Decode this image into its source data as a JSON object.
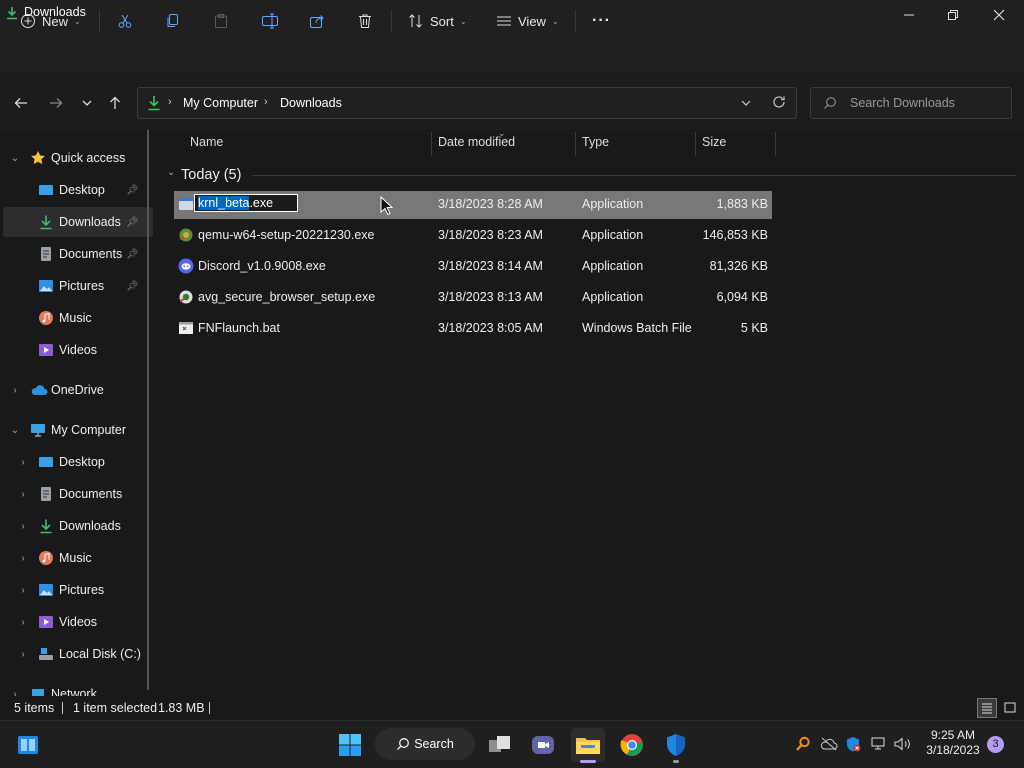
{
  "window": {
    "title": "Downloads"
  },
  "toolbar": {
    "new_label": "New",
    "sort_label": "Sort",
    "view_label": "View",
    "more_label": "···"
  },
  "address": {
    "crumbs": [
      "My Computer",
      "Downloads"
    ],
    "search_placeholder": "Search Downloads"
  },
  "sidebar": {
    "quick_access": {
      "label": "Quick access",
      "items": [
        {
          "label": "Desktop",
          "icon": "desktop-icon",
          "pinned": true
        },
        {
          "label": "Downloads",
          "icon": "download-icon",
          "pinned": true,
          "selected": true
        },
        {
          "label": "Documents",
          "icon": "document-icon",
          "pinned": true
        },
        {
          "label": "Pictures",
          "icon": "picture-icon",
          "pinned": true
        },
        {
          "label": "Music",
          "icon": "music-icon",
          "pinned": false
        },
        {
          "label": "Videos",
          "icon": "video-icon",
          "pinned": false
        }
      ]
    },
    "onedrive": {
      "label": "OneDrive"
    },
    "my_computer": {
      "label": "My Computer",
      "items": [
        {
          "label": "Desktop",
          "icon": "desktop-icon"
        },
        {
          "label": "Documents",
          "icon": "document-icon"
        },
        {
          "label": "Downloads",
          "icon": "download-icon"
        },
        {
          "label": "Music",
          "icon": "music-icon"
        },
        {
          "label": "Pictures",
          "icon": "picture-icon"
        },
        {
          "label": "Videos",
          "icon": "video-icon"
        },
        {
          "label": "Local Disk (C:)",
          "icon": "disk-icon"
        }
      ]
    },
    "network": {
      "label": "Network"
    }
  },
  "columns": {
    "name": "Name",
    "date": "Date modified",
    "type": "Type",
    "size": "Size"
  },
  "group": {
    "label": "Today (5)"
  },
  "files": [
    {
      "name": "krnl_beta.exe",
      "rename_selected": "krnl_beta",
      "rename_rest": ".exe",
      "date": "3/18/2023 8:28 AM",
      "type": "Application",
      "size": "1,883 KB",
      "icon": "app-icon",
      "selected": true
    },
    {
      "name": "qemu-w64-setup-20221230.exe",
      "date": "3/18/2023 8:23 AM",
      "type": "Application",
      "size": "146,853 KB",
      "icon": "installer-icon"
    },
    {
      "name": "Discord_v1.0.9008.exe",
      "date": "3/18/2023 8:14 AM",
      "type": "Application",
      "size": "81,326 KB",
      "icon": "discord-icon"
    },
    {
      "name": "avg_secure_browser_setup.exe",
      "date": "3/18/2023 8:13 AM",
      "type": "Application",
      "size": "6,094 KB",
      "icon": "installer-icon"
    },
    {
      "name": "FNFlaunch.bat",
      "date": "3/18/2023 8:05 AM",
      "type": "Windows Batch File",
      "size": "5 KB",
      "icon": "batch-file-icon"
    }
  ],
  "status": {
    "items": "5 items",
    "selection": "1 item selected",
    "size": "1.83 MB"
  },
  "taskbar": {
    "search_label": "Search",
    "time": "9:25 AM",
    "date": "3/18/2023",
    "notifications": "3"
  },
  "colors": {
    "accent": "#0067c0",
    "download_green": "#3fbf6c",
    "folder_yellow": "#f4c542"
  }
}
